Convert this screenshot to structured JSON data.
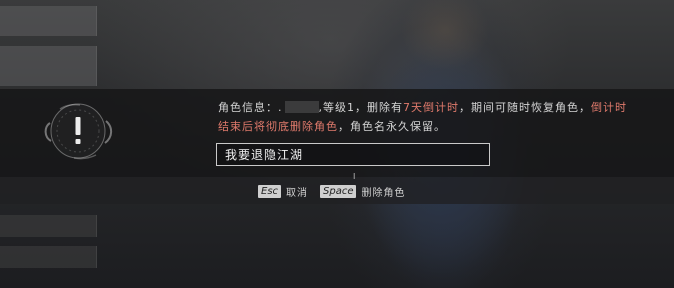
{
  "dialog": {
    "prefix": "角色信息：.",
    "level": ",等级1，",
    "delete_has": "删除有",
    "countdown": "7天倒计时",
    "middle": "，期间可随时恢复角色，",
    "countdown_line1": "倒计时",
    "countdown_line2": "结束后将彻底删除角色",
    "suffix": "，角色名永久保留。",
    "input_value": "我要退隐江湖",
    "cursor_glyph": "I"
  },
  "hints": [
    {
      "key": "Esc",
      "label": "取消"
    },
    {
      "key": "Space",
      "label": "删除角色"
    }
  ],
  "icons": {
    "emblem": "warning-emblem-icon"
  },
  "colors": {
    "highlight": "#e07a6c",
    "overlay": "#161618"
  }
}
